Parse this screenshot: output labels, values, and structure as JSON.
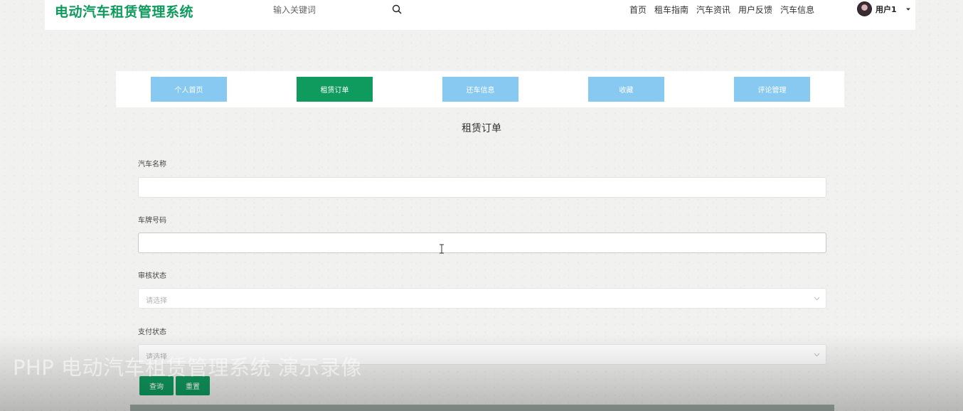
{
  "header": {
    "logo": "电动汽车租赁管理系统",
    "search_placeholder": "输入关键词",
    "nav": [
      "首页",
      "租车指南",
      "汽车资讯",
      "用户反馈",
      "汽车信息"
    ],
    "user_name": "用户1"
  },
  "tabs": [
    {
      "label": "个人首页",
      "active": false
    },
    {
      "label": "租赁订单",
      "active": true
    },
    {
      "label": "还车信息",
      "active": false
    },
    {
      "label": "收藏",
      "active": false
    },
    {
      "label": "评论管理",
      "active": false
    }
  ],
  "page_title": "租赁订单",
  "form": {
    "car_name_label": "汽车名称",
    "car_name_value": "",
    "plate_label": "车牌号码",
    "plate_value": "",
    "review_label": "审核状态",
    "review_placeholder": "请选择",
    "pay_label": "支付状态",
    "pay_placeholder": "请选择",
    "query_button": "查询",
    "reset_button": "重置"
  },
  "watermark": "PHP 电动汽车租赁管理系统 演示录像",
  "colors": {
    "brand_green": "#0f9a5e",
    "tab_blue": "#87c9f0"
  }
}
